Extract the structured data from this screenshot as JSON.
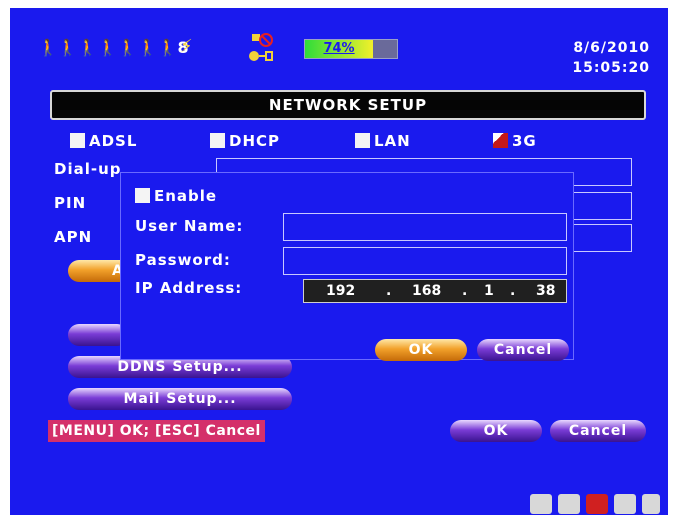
{
  "status": {
    "people_icons": "🚶🚶🚶🚶🚶🚶🚶8",
    "hdd_percent": "74%",
    "hdd_fill": 0.74,
    "date": "8/6/2010",
    "time": "15:05:20"
  },
  "title": "NETWORK SETUP",
  "modes": [
    {
      "label": "ADSL",
      "checked": false
    },
    {
      "label": "DHCP",
      "checked": false
    },
    {
      "label": "LAN",
      "checked": false
    },
    {
      "label": "3G",
      "checked": true
    }
  ],
  "fields": {
    "dialup_label": "Dial-up Number",
    "pin_label": "PIN",
    "apn_label": "APN"
  },
  "buttons": {
    "a_label": "A",
    "ddns_label": "DDNS Setup...",
    "mail_label": "Mail Setup...",
    "ok_label": "OK",
    "cancel_label": "Cancel"
  },
  "dialog": {
    "enable_label": "Enable",
    "username_label": "User Name:",
    "password_label": "Password:",
    "ip_label": "IP Address:",
    "ip": [
      "192",
      ".",
      "168",
      ".",
      "1",
      ".",
      "38"
    ],
    "ok_label": "OK",
    "cancel_label": "Cancel"
  },
  "hint": "[MENU] OK; [ESC] Cancel",
  "colors": {
    "background": "#1a1aee",
    "accent_orange": "#f2a12a",
    "accent_purple": "#7a3cd6",
    "hint_bg": "#d4306a"
  }
}
